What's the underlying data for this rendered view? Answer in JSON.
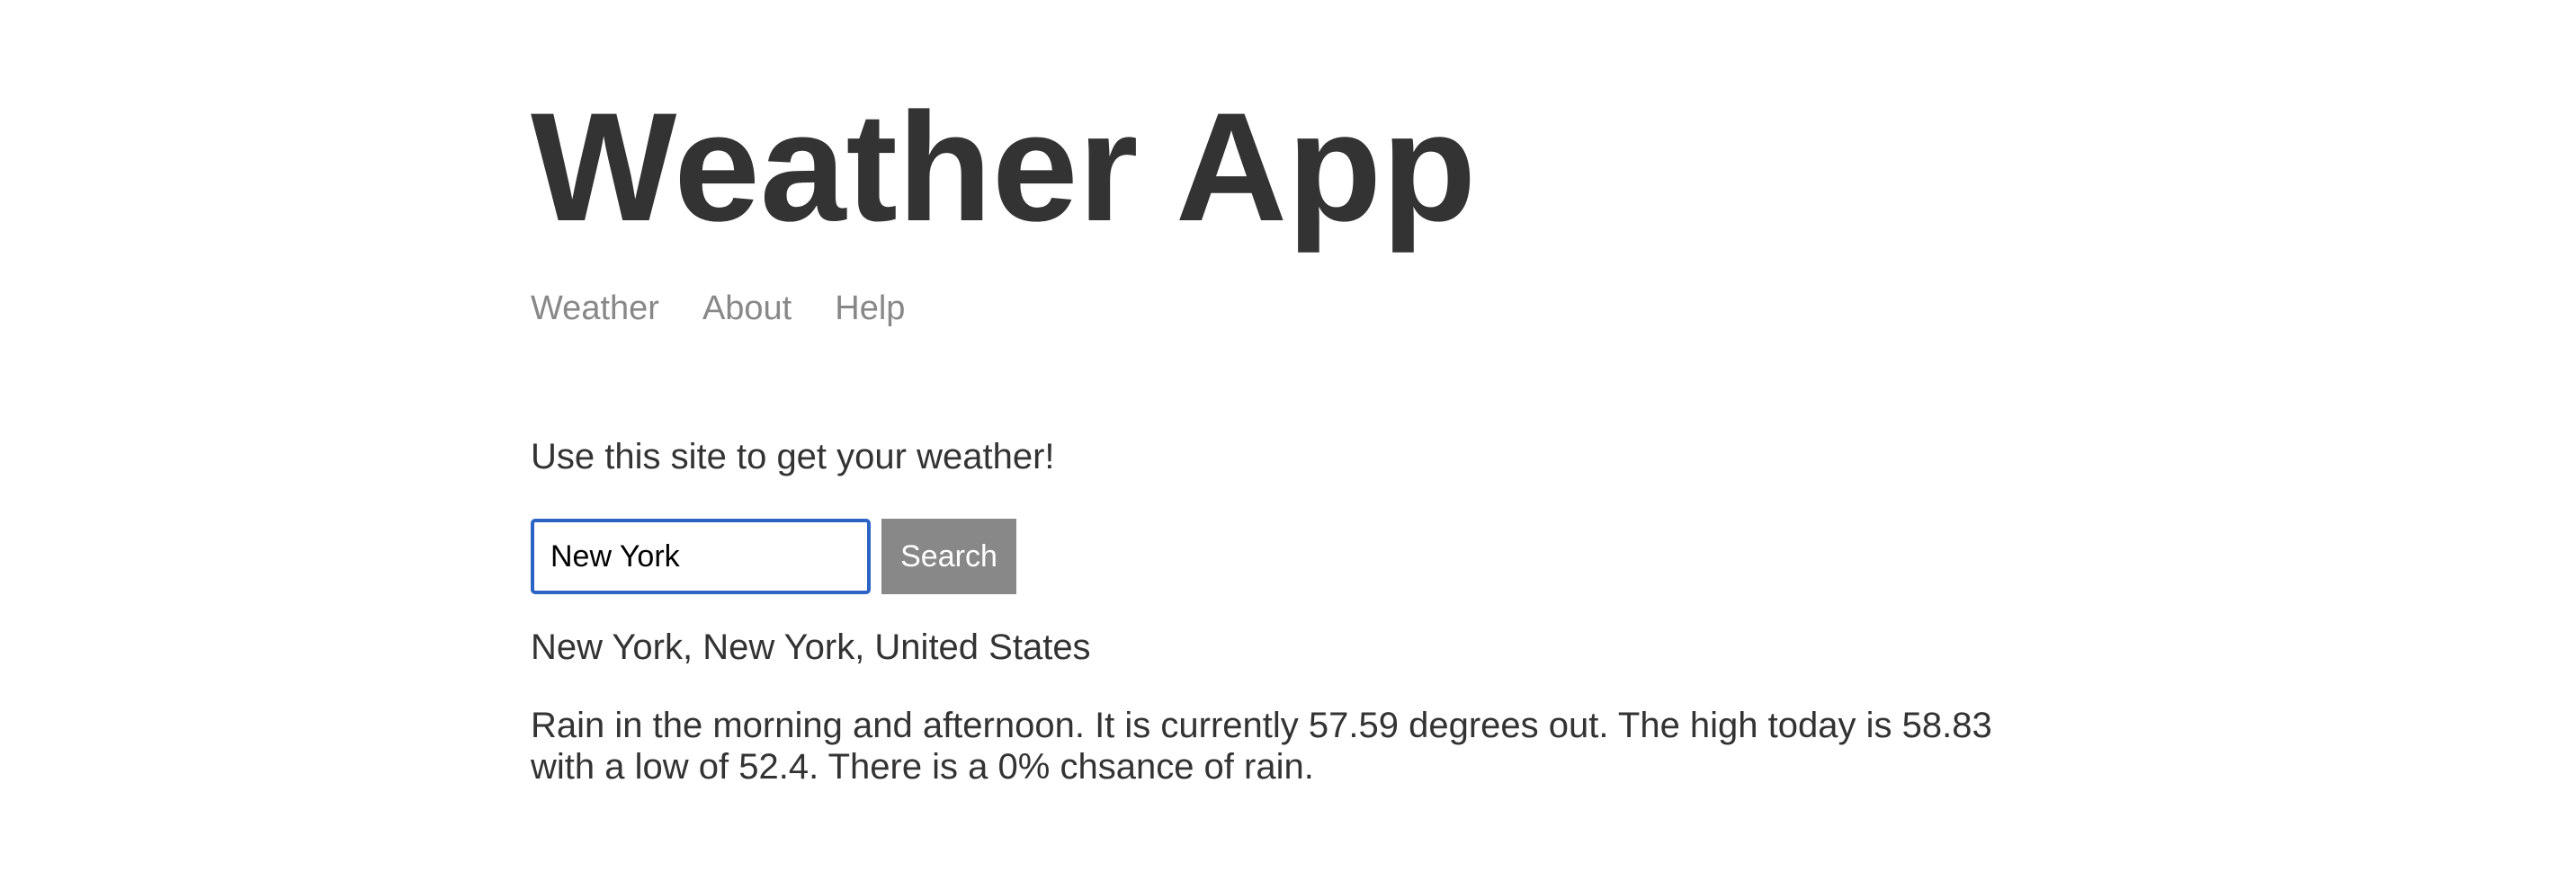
{
  "header": {
    "title": "Weather App"
  },
  "nav": {
    "items": [
      {
        "label": "Weather"
      },
      {
        "label": "About"
      },
      {
        "label": "Help"
      }
    ]
  },
  "main": {
    "intro": "Use this site to get your weather!",
    "search": {
      "value": "New York",
      "button_label": "Search"
    },
    "result": {
      "location": "New York, New York, United States",
      "forecast": "Rain in the morning and afternoon. It is currently 57.59 degrees out. The high today is 58.83 with a low of 52.4. There is a 0% chsance of rain."
    }
  },
  "colors": {
    "text": "#333333",
    "nav_link": "#888888",
    "button_bg": "#888888",
    "input_focus_border": "#2b64c4"
  }
}
